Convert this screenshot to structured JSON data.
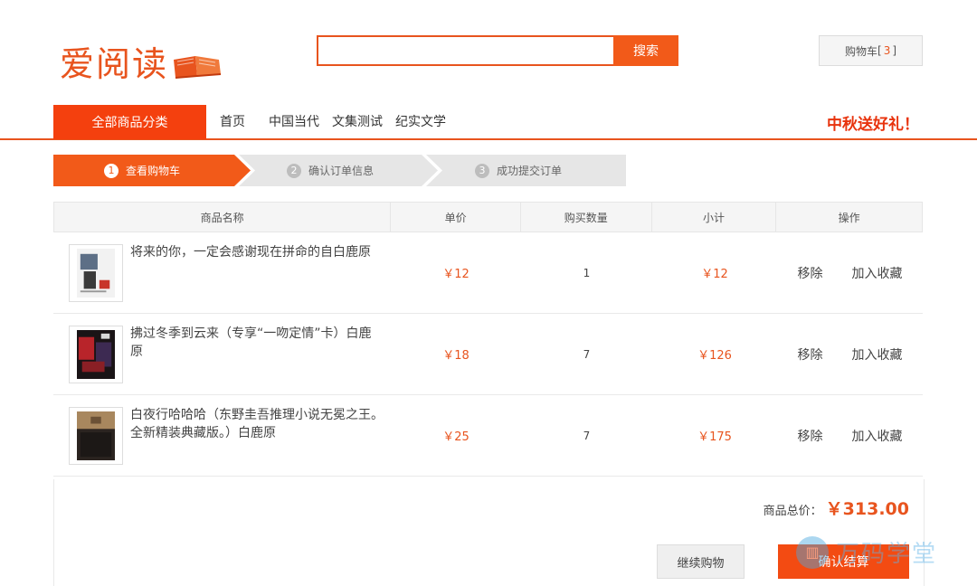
{
  "header": {
    "logo_text": "爱阅读",
    "search_placeholder": "",
    "search_button": "搜索",
    "cart_label": "购物车",
    "cart_count": "3"
  },
  "nav": {
    "category": "全部商品分类",
    "links": [
      "首页",
      "中国当代",
      "文集测试",
      "纪实文学"
    ],
    "promo": "中秋送好礼！"
  },
  "steps": [
    {
      "num": "1",
      "label": "查看购物车",
      "active": true
    },
    {
      "num": "2",
      "label": "确认订单信息",
      "active": false
    },
    {
      "num": "3",
      "label": "成功提交订单",
      "active": false
    }
  ],
  "table": {
    "headers": [
      "商品名称",
      "单价",
      "购买数量",
      "小计",
      "操作"
    ],
    "rows": [
      {
        "name": "将来的你，一定会感谢现在拼命的自白鹿原",
        "price": "￥12",
        "qty": "1",
        "subtotal": "￥12",
        "remove": "移除",
        "favorite": "加入收藏"
      },
      {
        "name": "拂过冬季到云来（专享“一吻定情”卡）白鹿原",
        "price": "￥18",
        "qty": "7",
        "subtotal": "￥126",
        "remove": "移除",
        "favorite": "加入收藏"
      },
      {
        "name": "白夜行哈哈哈（东野圭吾推理小说无冕之王。全新精装典藏版。）白鹿原",
        "price": "￥25",
        "qty": "7",
        "subtotal": "￥175",
        "remove": "移除",
        "favorite": "加入收藏"
      }
    ]
  },
  "footer": {
    "total_label": "商品总价：",
    "total_value": "￥313.00",
    "continue_button": "继续购物",
    "confirm_button": "确认结算"
  },
  "watermark": {
    "text": "万码学堂"
  },
  "colors": {
    "accent": "#f25a19",
    "price": "#e8541e",
    "promo": "#e8330d"
  }
}
